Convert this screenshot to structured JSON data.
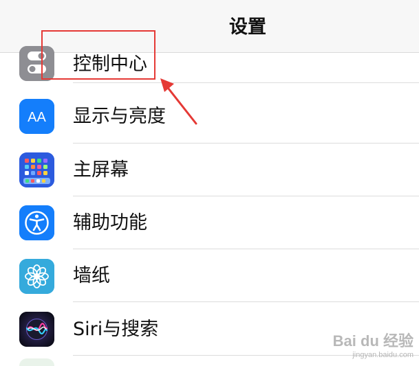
{
  "nav": {
    "title": "设置"
  },
  "items": [
    {
      "label": "控制中心",
      "icon": "control-center-icon",
      "color": "#8e8e93"
    },
    {
      "label": "显示与亮度",
      "icon": "display-brightness-icon",
      "color": "#147efb",
      "glyph": "AA"
    },
    {
      "label": "主屏幕",
      "icon": "home-screen-icon",
      "color": "#2c5bde"
    },
    {
      "label": "辅助功能",
      "icon": "accessibility-icon",
      "color": "#147efb"
    },
    {
      "label": "墙纸",
      "icon": "wallpaper-icon",
      "color": "#35aadc"
    },
    {
      "label": "Siri与搜索",
      "icon": "siri-icon",
      "color": "#1b1b2f"
    }
  ],
  "annotation": {
    "color": "#e53935"
  },
  "watermark": {
    "brand": "Bai du 经验",
    "url": "jingyan.baidu.com"
  }
}
